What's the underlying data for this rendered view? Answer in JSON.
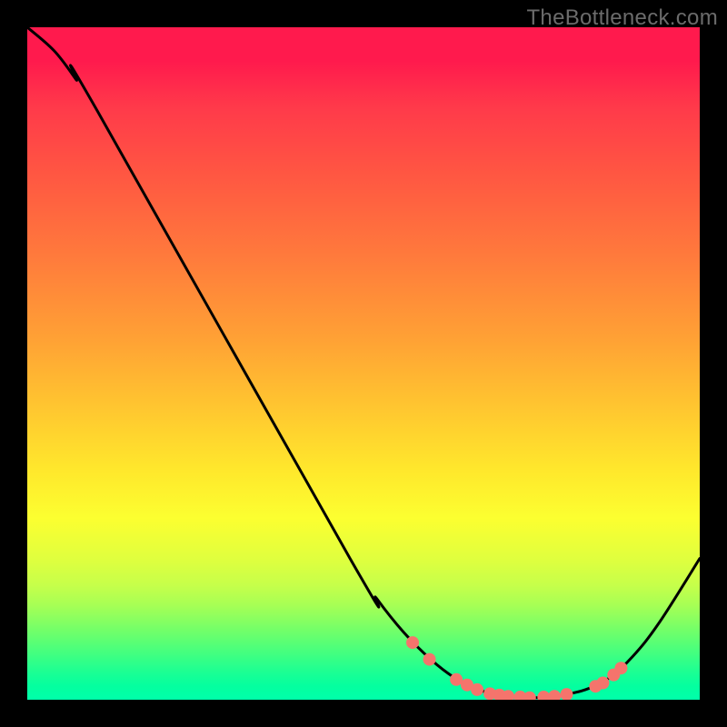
{
  "watermark": "TheBottleneck.com",
  "colors": {
    "background": "#000000",
    "curve_stroke": "#000000",
    "dot_fill": "#f5746c",
    "gradient_top": "#ff1a4d",
    "gradient_bottom": "#00ffaa"
  },
  "chart_data": {
    "type": "line",
    "title": "",
    "xlabel": "",
    "ylabel": "",
    "xlim": [
      0,
      100
    ],
    "ylim": [
      0,
      100
    ],
    "curve": [
      {
        "x": 0.0,
        "y": 100.0
      },
      {
        "x": 4.0,
        "y": 96.5
      },
      {
        "x": 7.2,
        "y": 92.3
      },
      {
        "x": 10.4,
        "y": 87.6
      },
      {
        "x": 48.0,
        "y": 21.0
      },
      {
        "x": 52.0,
        "y": 15.0
      },
      {
        "x": 56.0,
        "y": 10.0
      },
      {
        "x": 60.0,
        "y": 6.0
      },
      {
        "x": 63.5,
        "y": 3.3
      },
      {
        "x": 67.0,
        "y": 1.5
      },
      {
        "x": 71.0,
        "y": 0.6
      },
      {
        "x": 75.0,
        "y": 0.3
      },
      {
        "x": 79.0,
        "y": 0.6
      },
      {
        "x": 83.0,
        "y": 1.5
      },
      {
        "x": 86.5,
        "y": 3.2
      },
      {
        "x": 90.0,
        "y": 6.4
      },
      {
        "x": 94.0,
        "y": 11.5
      },
      {
        "x": 100.0,
        "y": 21.0
      }
    ],
    "dots": [
      {
        "x": 57.3,
        "y": 8.5
      },
      {
        "x": 59.8,
        "y": 6.0
      },
      {
        "x": 63.8,
        "y": 3.0
      },
      {
        "x": 65.4,
        "y": 2.2
      },
      {
        "x": 66.9,
        "y": 1.5
      },
      {
        "x": 68.8,
        "y": 0.9
      },
      {
        "x": 70.2,
        "y": 0.7
      },
      {
        "x": 71.5,
        "y": 0.5
      },
      {
        "x": 73.3,
        "y": 0.4
      },
      {
        "x": 74.7,
        "y": 0.3
      },
      {
        "x": 76.8,
        "y": 0.4
      },
      {
        "x": 78.4,
        "y": 0.5
      },
      {
        "x": 80.2,
        "y": 0.8
      },
      {
        "x": 84.5,
        "y": 2.0
      },
      {
        "x": 85.6,
        "y": 2.5
      },
      {
        "x": 87.2,
        "y": 3.7
      },
      {
        "x": 88.3,
        "y": 4.7
      }
    ]
  }
}
